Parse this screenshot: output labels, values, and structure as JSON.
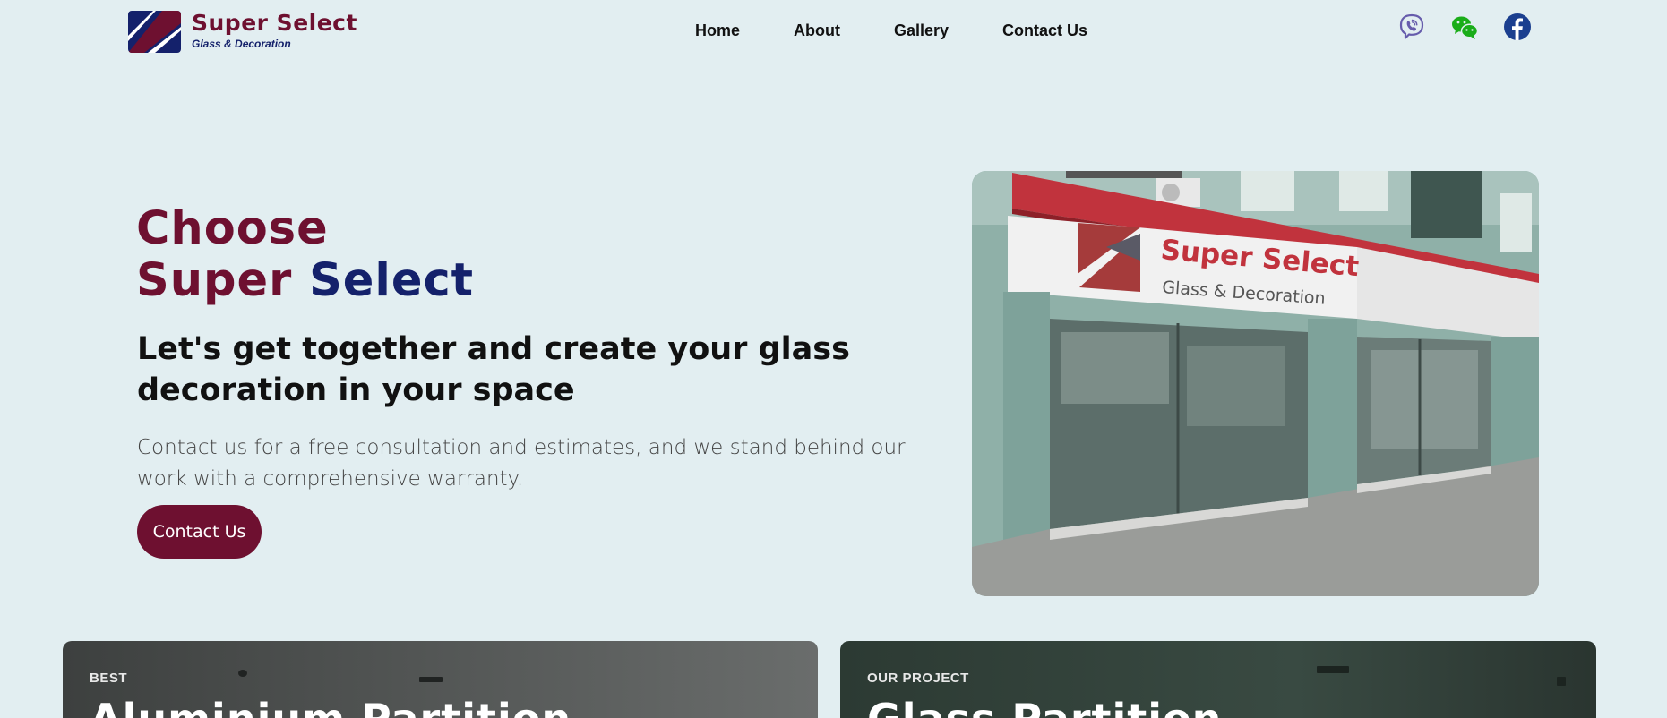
{
  "brand": {
    "name": "Super Select",
    "tagline": "Glass & Decoration",
    "primary_color": "#6e1030",
    "secondary_color": "#14216b"
  },
  "nav": {
    "items": [
      {
        "label": "Home"
      },
      {
        "label": "About"
      },
      {
        "label": "Gallery"
      },
      {
        "label": "Contact Us"
      }
    ]
  },
  "socials": [
    {
      "icon": "viber-icon",
      "color": "#665cac"
    },
    {
      "icon": "wechat-icon",
      "color": "#1aad19"
    },
    {
      "icon": "facebook-icon",
      "color": "#1b3f8f"
    }
  ],
  "hero": {
    "title_line1": "Choose",
    "title_line2_a": "Super",
    "title_line2_b": "Select",
    "heading": "Let's get together and create your glass decoration in your space",
    "description": "Contact us for a free consultation and estimates, and we stand behind our work with a comprehensive warranty.",
    "cta_label": "Contact Us",
    "image_sign_name": "Super Select",
    "image_sign_sub": "Glass & Decoration"
  },
  "cards": [
    {
      "label": "BEST",
      "title": "Aluminium Partition"
    },
    {
      "label": "OUR PROJECT",
      "title": "Glass Partition"
    }
  ]
}
